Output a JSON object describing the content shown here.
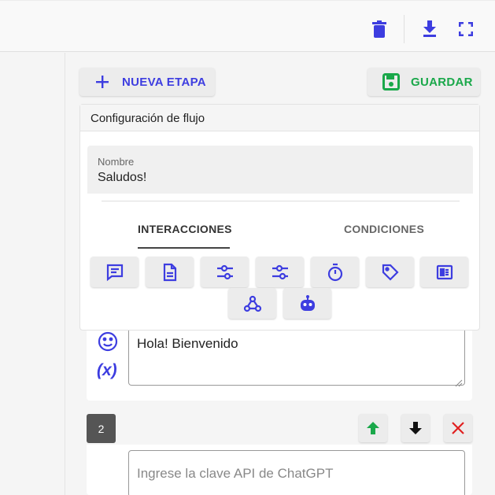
{
  "toolbar": {
    "delete_icon": "trash-icon",
    "download_icon": "download-icon",
    "fullscreen_icon": "fullscreen-icon"
  },
  "actions": {
    "new_stage_label": "NUEVA ETAPA",
    "save_label": "GUARDAR"
  },
  "flow_config": {
    "title": "Configuración de flujo",
    "name_label": "Nombre",
    "name_value": "Saludos!",
    "tabs": [
      "INTERACCIONES",
      "CONDICIONES"
    ],
    "active_tab": "INTERACCIONES",
    "tools": [
      "message-icon",
      "document-icon",
      "options-icon",
      "options-icon",
      "timer-icon",
      "tag-icon",
      "list-icon",
      "webhook-icon",
      "robot-icon"
    ]
  },
  "message": {
    "text": "Hola! Bienvenido",
    "emoji_icon": "emoji-icon",
    "variable_label": "(x)"
  },
  "step": {
    "number": "2",
    "api_placeholder": "Ingrese la clave API de ChatGPT"
  },
  "colors": {
    "accent": "#3d3de0",
    "green": "#1aa84a",
    "red": "#e02020"
  }
}
